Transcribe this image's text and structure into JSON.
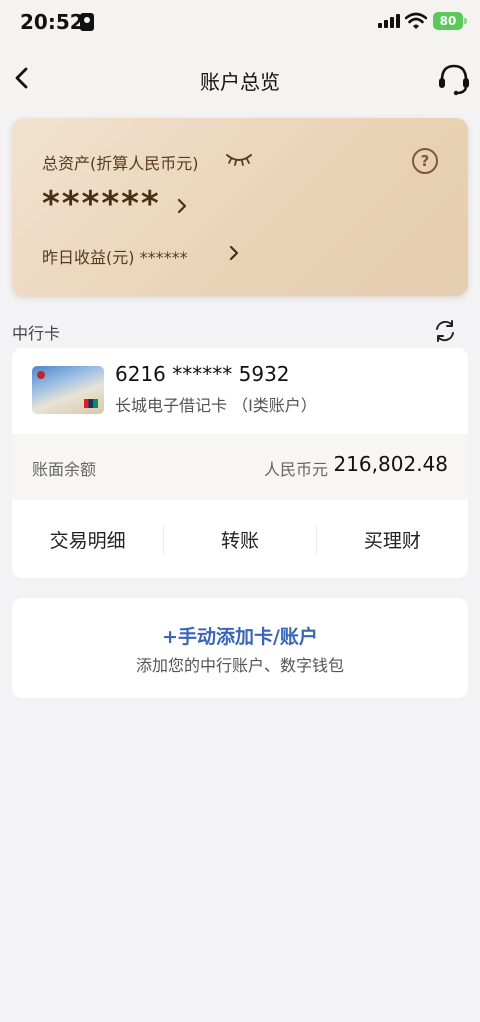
{
  "status_bar": {
    "time": "20:52",
    "battery": "80"
  },
  "nav": {
    "title": "账户总览"
  },
  "asset_card": {
    "label": "总资产(折算人民币元)",
    "value": "******",
    "yield_label": "昨日收益(元) ******",
    "help": "?"
  },
  "section": {
    "title": "中行卡"
  },
  "account": {
    "card_number": "6216 ****** 5932",
    "card_type": "长城电子借记卡 （I类账户）",
    "balance_label": "账面余额",
    "currency": "人民币元",
    "balance": "216,802.48",
    "actions": [
      "交易明细",
      "转账",
      "买理财"
    ]
  },
  "add_account": {
    "title": "+手动添加卡/账户",
    "subtitle": "添加您的中行账户、数字钱包"
  },
  "colors": {
    "accent_blue": "#3a66b8",
    "card_gold": "#ead2b6",
    "battery_green": "#5ac95a"
  }
}
